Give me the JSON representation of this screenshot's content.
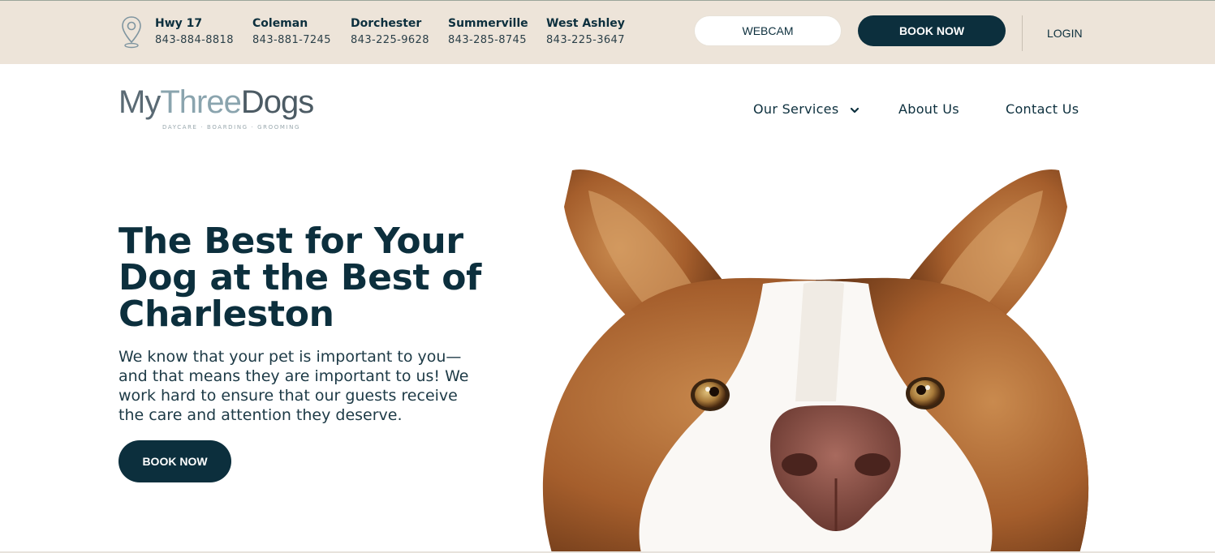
{
  "topbar": {
    "locations": [
      {
        "name": "Hwy 17",
        "phone": "843-884-8818"
      },
      {
        "name": "Coleman",
        "phone": "843-881-7245"
      },
      {
        "name": "Dorchester",
        "phone": "843-225-9628"
      },
      {
        "name": "Summerville",
        "phone": "843-285-8745"
      },
      {
        "name": "West Ashley",
        "phone": "843-225-3647"
      }
    ],
    "webcam_label": "WEBCAM",
    "book_label": "BOOK NOW",
    "login_label": "LOGIN"
  },
  "logo": {
    "part1": "My",
    "part2": "Three",
    "part3": "Dogs",
    "tagline": "DAYCARE · BOARDING · GROOMING"
  },
  "nav": {
    "services": "Our Services",
    "about": "About Us",
    "contact": "Contact Us"
  },
  "hero": {
    "title": "The Best for Your Dog at the Best of Charleston",
    "text": "We know that your pet is important to you—and that means they are important to us! We work hard to ensure that our guests receive the care and attention they deserve.",
    "button": "BOOK NOW"
  },
  "icons": {
    "pin": "location-pin-icon",
    "chevron": "chevron-down-icon"
  },
  "colors": {
    "primary": "#0c2f3d",
    "topbar_bg": "#ede4d9",
    "white": "#ffffff"
  }
}
